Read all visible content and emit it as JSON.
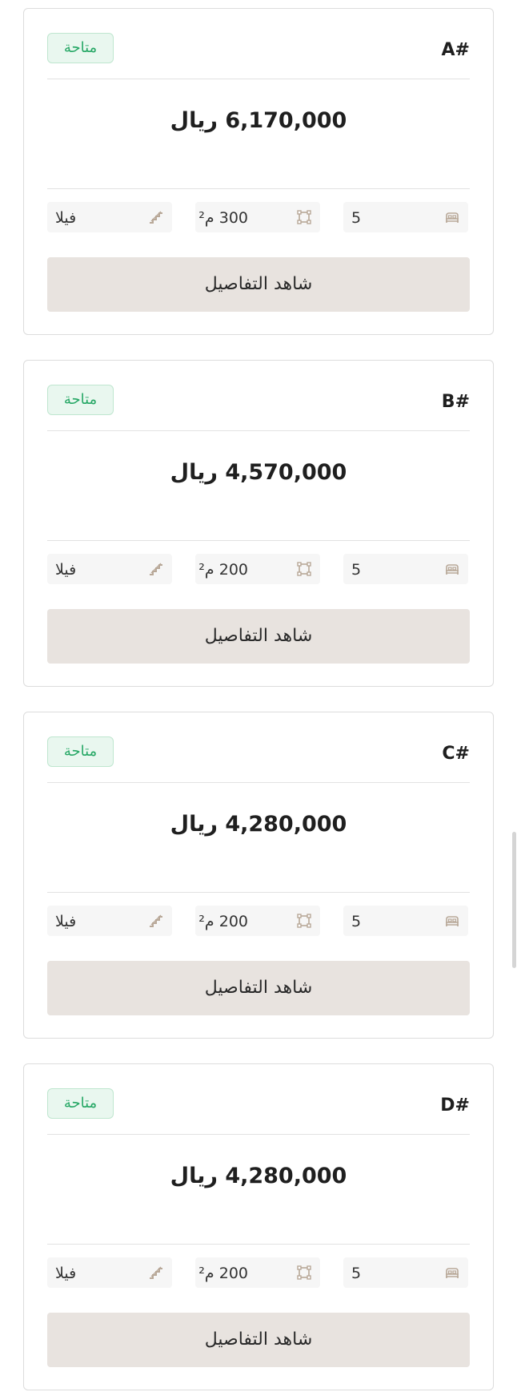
{
  "cards": [
    {
      "code": "A#",
      "status": "متاحة",
      "price": "6,170,000 ريال",
      "type": "فيلا",
      "area": "300 م²",
      "bedrooms": "5",
      "button_label": "شاهد التفاصيل"
    },
    {
      "code": "B#",
      "status": "متاحة",
      "price": "4,570,000 ريال",
      "type": "فيلا",
      "area": "200 م²",
      "bedrooms": "5",
      "button_label": "شاهد التفاصيل"
    },
    {
      "code": "C#",
      "status": "متاحة",
      "price": "4,280,000 ريال",
      "type": "فيلا",
      "area": "200 م²",
      "bedrooms": "5",
      "button_label": "شاهد التفاصيل"
    },
    {
      "code": "D#",
      "status": "متاحة",
      "price": "4,280,000 ريال",
      "type": "فيلا",
      "area": "200 م²",
      "bedrooms": "5",
      "button_label": "شاهد التفاصيل"
    }
  ],
  "icons": {
    "type": "stairs-icon",
    "area": "area-frame-icon",
    "bedrooms": "bed-icon"
  },
  "colors": {
    "badge_text": "#27a866",
    "badge_bg": "#e9f7ef",
    "button_bg": "#e8e3df",
    "icon": "#b8a898"
  }
}
